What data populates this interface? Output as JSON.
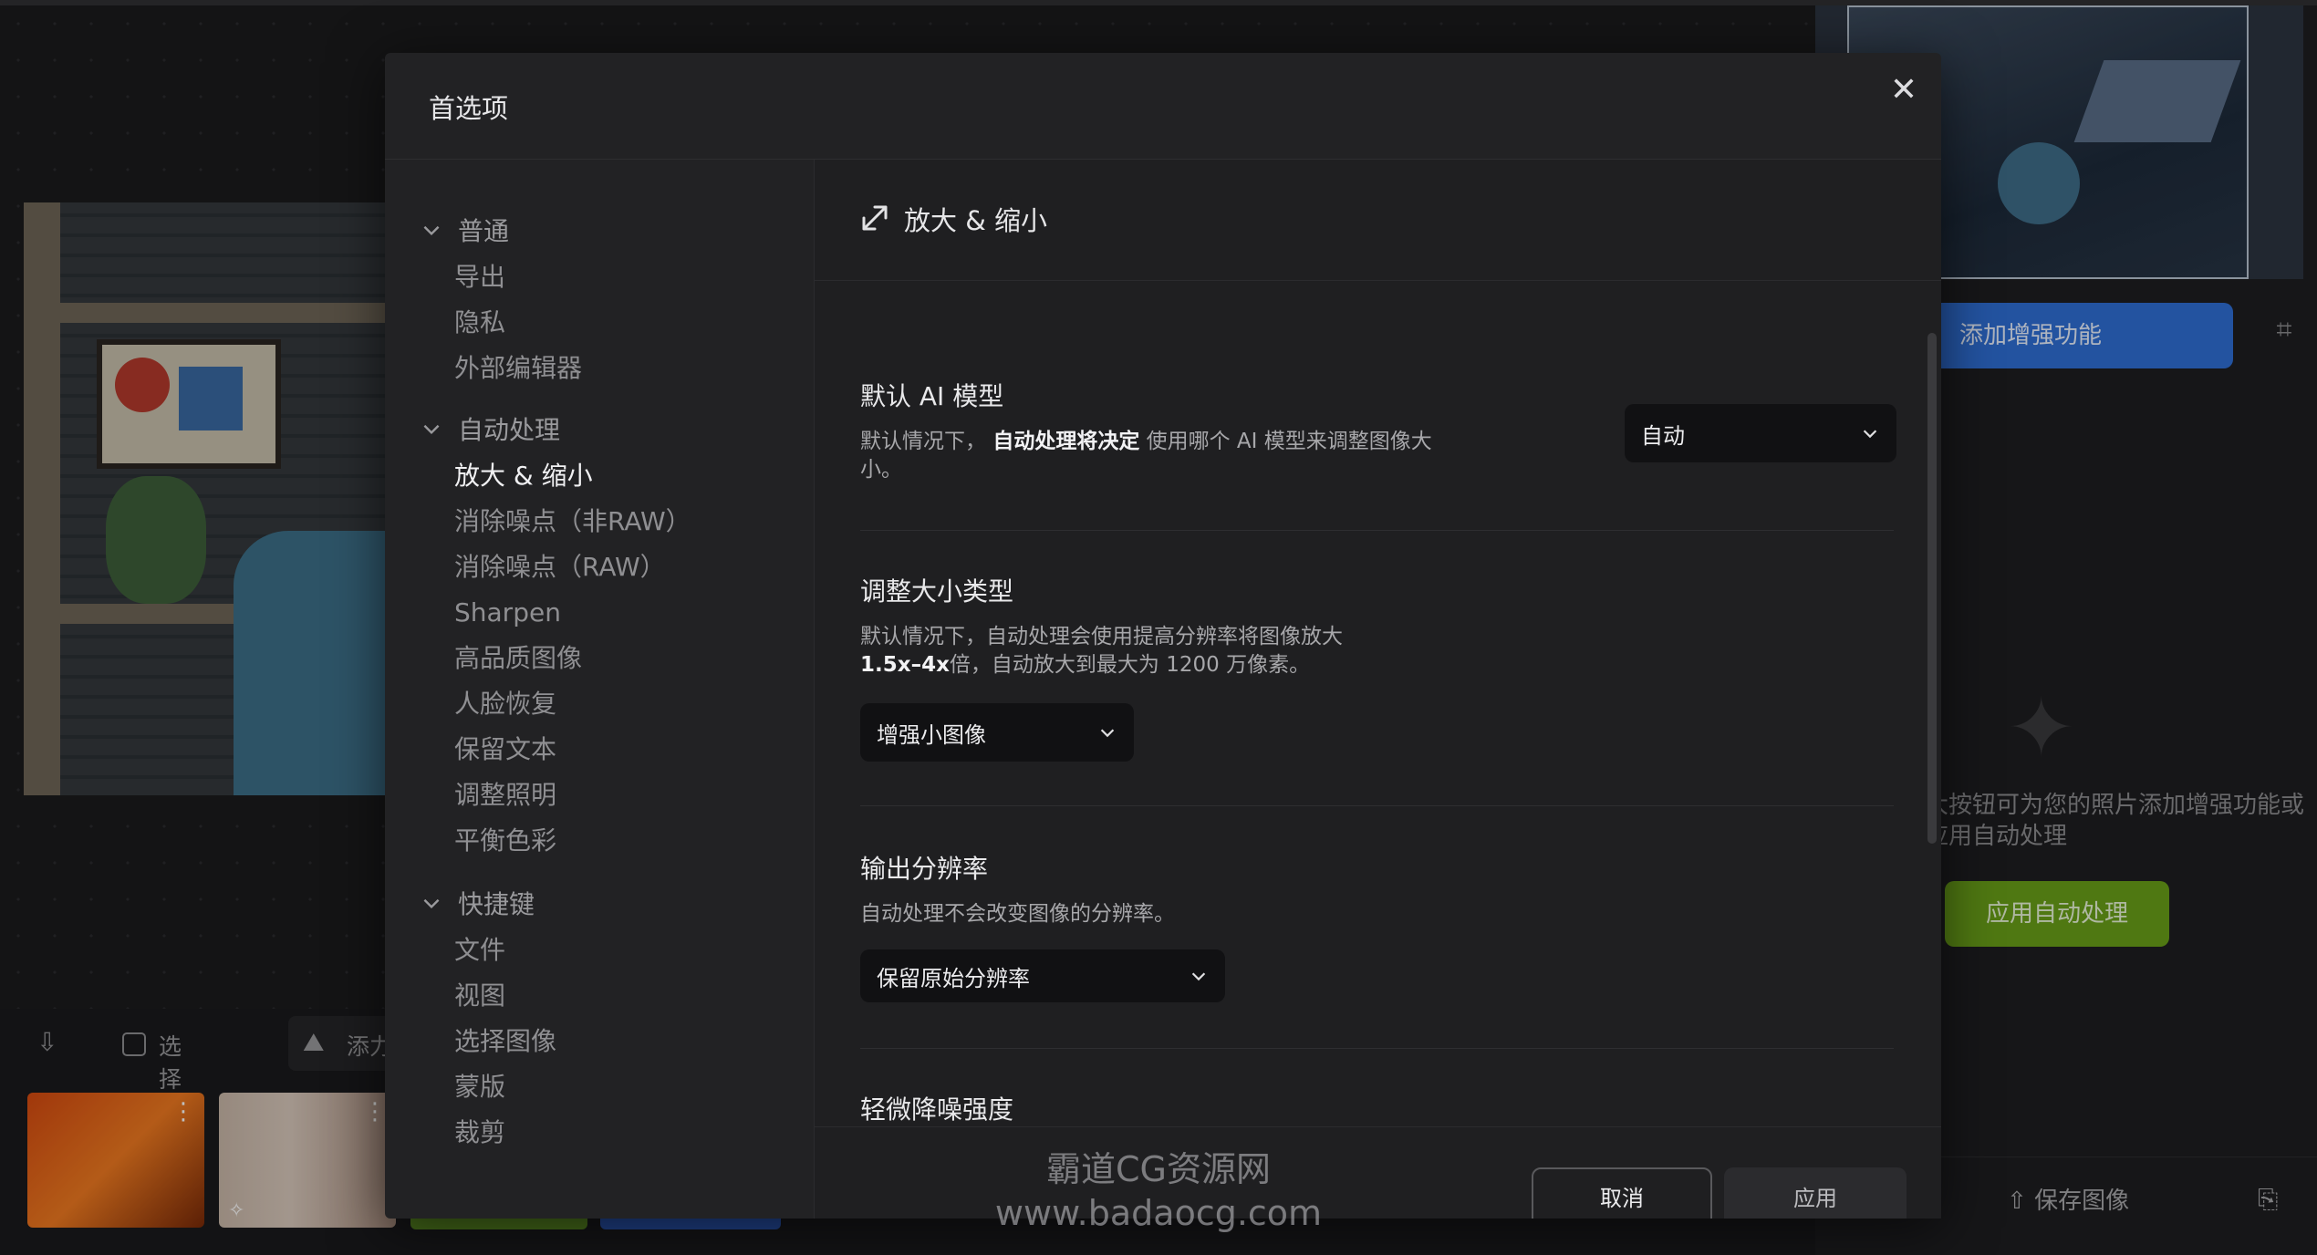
{
  "background": {
    "select_all_label": "选择全部",
    "add_label": "添力",
    "enhance_button": "添加增强功能",
    "hint_text": "大按钮可为您的照片添加增强功能或应用自动处理",
    "auto_process_button": "应用自动处理",
    "save_image_button": "保存图像"
  },
  "dialog": {
    "title": "首选项",
    "nav": {
      "groups": [
        {
          "label": "普通",
          "items": [
            "导出",
            "隐私",
            "外部编辑器"
          ]
        },
        {
          "label": "自动处理",
          "items": [
            "放大 & 缩小",
            "消除噪点（非RAW）",
            "消除噪点（RAW）",
            "Sharpen",
            "高品质图像",
            "人脸恢复",
            "保留文本",
            "调整照明",
            "平衡色彩"
          ]
        },
        {
          "label": "快捷键",
          "items": [
            "文件",
            "视图",
            "选择图像",
            "蒙版",
            "裁剪"
          ]
        }
      ],
      "active_item": "放大 & 缩小"
    },
    "content": {
      "header_title": "放大 & 缩小",
      "sections": {
        "model": {
          "title": "默认 AI 模型",
          "desc_prefix": "默认情况下，",
          "desc_bold": "自动处理将决定",
          "desc_suffix": "使用哪个 AI 模型来调整图像大小。",
          "dropdown_value": "自动"
        },
        "resize_type": {
          "title": "调整大小类型",
          "desc_line1": "默认情况下，自动处理会使用提高分辨率将图像放大",
          "desc_bold": "1.5x–4x",
          "desc_suffix": "倍，自动放大到最大为 1200 万像素。",
          "dropdown_value": "增强小图像"
        },
        "output_res": {
          "title": "输出分辨率",
          "desc": "自动处理不会改变图像的分辨率。",
          "dropdown_value": "保留原始分辨率"
        },
        "denoise": {
          "title": "轻微降噪强度"
        }
      },
      "cancel_label": "取消",
      "apply_label": "应用"
    }
  },
  "watermark": {
    "line1": "霸道CG资源网",
    "line2": "www.badaocg.com"
  }
}
